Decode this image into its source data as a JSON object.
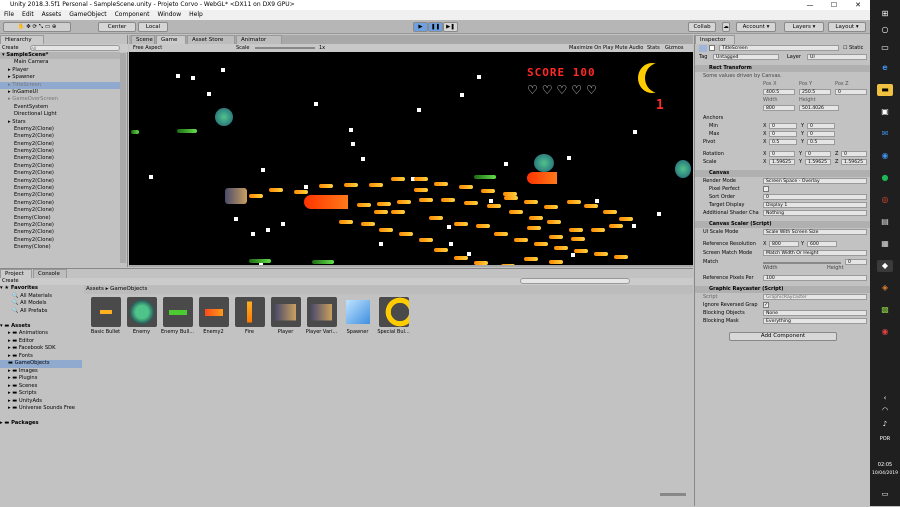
{
  "window": {
    "title": "Unity 2018.3.5f1 Personal - SampleScene.unity - Projeto Corvo - WebGL* <DX11 on DX9 GPU>"
  },
  "menu": [
    "File",
    "Edit",
    "Assets",
    "GameObject",
    "Component",
    "Window",
    "Help"
  ],
  "toolbar": {
    "pivot": "Center",
    "space": "Local",
    "collab": "Collab",
    "account": "Account",
    "layers": "Layers",
    "layout": "Layout"
  },
  "hierarchy": {
    "tab": "Hierarchy",
    "create": "Create",
    "search_placeholder": "All",
    "scene": "SampleScene*",
    "items": [
      "Main Camera",
      "Player",
      "Spawner",
      "TitleScreen",
      "InGameUI",
      "GameOverScreen",
      "EventSystem",
      "Directional Light",
      "Stars",
      "Enemy2(Clone)",
      "Enemy2(Clone)",
      "Enemy2(Clone)",
      "Enemy2(Clone)",
      "Enemy2(Clone)",
      "Enemy2(Clone)",
      "Enemy2(Clone)",
      "Enemy2(Clone)",
      "Enemy2(Clone)",
      "Enemy2(Clone)",
      "Enemy2(Clone)",
      "Enemy2(Clone)",
      "Enemy(Clone)",
      "Enemy2(Clone)",
      "Enemy2(Clone)",
      "Enemy2(Clone)",
      "Enemy(Clone)"
    ]
  },
  "views": {
    "scene_tab": "Scene",
    "game_tab": "Game",
    "asset_store_tab": "Asset Store",
    "animator_tab": "Animator"
  },
  "gamebar": {
    "aspect": "Free Aspect",
    "scale_label": "Scale",
    "scale_value": "1x",
    "maximize": "Maximize On Play",
    "mute": "Mute Audio",
    "stats": "Stats",
    "gizmos": "Gizmos"
  },
  "game": {
    "score_label": "SCORE",
    "score_value": "100",
    "lives": "1"
  },
  "inspector": {
    "tab": "Inspector",
    "object_name": "TitleScreen",
    "static_label": "Static",
    "tag_label": "Tag",
    "tag_value": "Untagged",
    "layer_label": "Layer",
    "layer_value": "UI",
    "rect_title": "Rect Transform",
    "rect_note": "Some values driven by Canvas.",
    "pos_headers": [
      "Pos X",
      "Pos Y",
      "Pos Z"
    ],
    "pos_values": [
      "400.5",
      "250.5",
      "0"
    ],
    "size_headers": [
      "Width",
      "Height"
    ],
    "size_values": [
      "800",
      "501.4026"
    ],
    "anchors_label": "Anchors",
    "min_label": "Min",
    "min_x": "0",
    "min_y": "0",
    "max_label": "Max",
    "max_x": "0",
    "max_y": "0",
    "pivot_label": "Pivot",
    "pivot_x": "0.5",
    "pivot_y": "0.5",
    "rotation_label": "Rotation",
    "rot_x": "0",
    "rot_y": "0",
    "rot_z": "0",
    "scale_label": "Scale",
    "scale_x": "1.59625",
    "scale_y": "1.59625",
    "scale_z": "1.59625",
    "canvas_title": "Canvas",
    "render_mode_label": "Render Mode",
    "render_mode_value": "Screen Space - Overlay",
    "pixel_perfect_label": "Pixel Perfect",
    "sort_order_label": "Sort Order",
    "sort_order_value": "0",
    "target_display_label": "Target Display",
    "target_display_value": "Display 1",
    "shader_label": "Additional Shader Cha",
    "shader_value": "Nothing",
    "scaler_title": "Canvas Scaler (Script)",
    "ui_scale_label": "UI Scale Mode",
    "ui_scale_value": "Scale With Screen Size",
    "ref_res_label": "Reference Resolution",
    "ref_x": "800",
    "ref_y": "600",
    "match_mode_label": "Screen Match Mode",
    "match_mode_value": "Match Width Or Height",
    "match_label": "Match",
    "match_value": "0",
    "match_width": "Width",
    "match_height": "Height",
    "ref_ppu_label": "Reference Pixels Per",
    "ref_ppu_value": "100",
    "raycaster_title": "Graphic Raycaster (Script)",
    "script_label": "Script",
    "script_value": "GraphicRaycaster",
    "ignore_label": "Ignore Reversed Grap",
    "blocking_obj_label": "Blocking Objects",
    "blocking_obj_value": "None",
    "blocking_mask_label": "Blocking Mask",
    "blocking_mask_value": "Everything",
    "add_component": "Add Component"
  },
  "project": {
    "tab": "Project",
    "console_tab": "Console",
    "create": "Create",
    "breadcrumb": [
      "Assets",
      "GameObjects"
    ],
    "favorites": {
      "label": "Favorites",
      "items": [
        "All Materials",
        "All Models",
        "All Prefabs"
      ]
    },
    "assets_root": "Assets",
    "folders": [
      "Animations",
      "Editor",
      "Facebook SDK",
      "Fonts",
      "GameObjects",
      "Images",
      "Plugins",
      "Scenes",
      "Scripts",
      "UnityAds",
      "Universe Sounds Free"
    ],
    "packages": "Packages",
    "assets": [
      "Basic Bullet",
      "Enemy",
      "Enemy Bull...",
      "Enemy2",
      "Fire",
      "Player",
      "Player Vari...",
      "Spawner",
      "Special Bul..."
    ]
  },
  "taskbar": {
    "lang": "POR",
    "time": "02:05",
    "date": "10/04/2019"
  },
  "colors": {
    "score": "#ff2a2a",
    "moon": "#ffcc00",
    "bullet": "#ffb020",
    "green_shot": "#4ccc30",
    "selection": "#8fa9cf"
  }
}
